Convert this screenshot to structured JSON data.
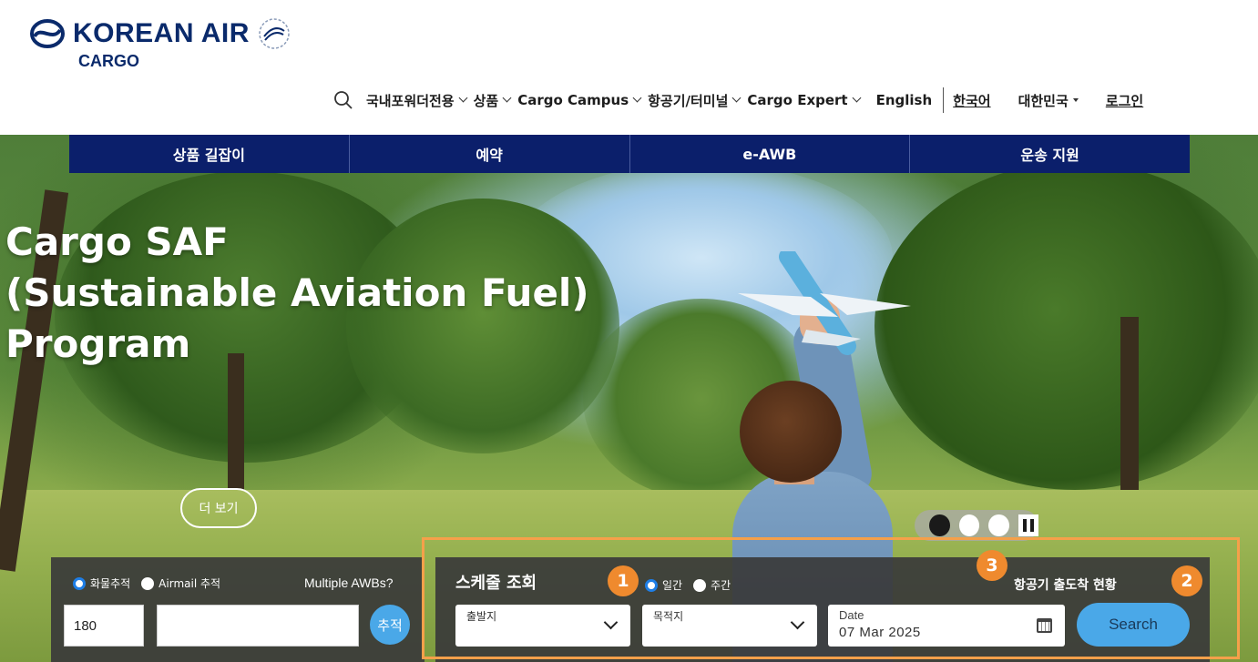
{
  "brand": {
    "name": "KOREAN AIR",
    "sub": "CARGO",
    "logo_icon": "korean-air-taeguk-logo",
    "emblem_icon": "skyteam-emblem",
    "color": "#0a2a6b"
  },
  "nav": {
    "search_icon": "search-icon",
    "items": [
      {
        "label": "국내포워더전용"
      },
      {
        "label": "상품"
      },
      {
        "label": "Cargo Campus"
      },
      {
        "label": "항공기/터미널"
      },
      {
        "label": "Cargo Expert"
      }
    ],
    "lang_en": "English",
    "lang_ko": "한국어",
    "region": "대한민국",
    "login": "로그인"
  },
  "tabs": [
    "상품 길잡이",
    "예약",
    "e-AWB",
    "운송 지원"
  ],
  "hero": {
    "headline_1": "Cargo SAF",
    "headline_2": "(Sustainable Aviation Fuel)",
    "headline_3": "Program",
    "more_label": "더 보기",
    "carousel": {
      "active_index": 0,
      "dots": 3,
      "control_icon": "pause-icon"
    }
  },
  "tracking": {
    "option_1": "화물추적",
    "option_2": "Airmail 추적",
    "selected": "화물추적",
    "multiple": "Multiple AWBs?",
    "prefix_value": "180",
    "awb_value": "",
    "button": "추적"
  },
  "schedule": {
    "title": "스케줄 조회",
    "option_daily": "일간",
    "option_weekly": "주간",
    "selected": "일간",
    "airport_status": "항공기 출도착 현황",
    "origin_label": "출발지",
    "destination_label": "목적지",
    "date_label": "Date",
    "date_value": "07 Mar 2025",
    "search_button": "Search"
  },
  "annotations": {
    "badge_1": "1",
    "badge_2": "2",
    "badge_3": "3",
    "color": "#f5a04a"
  },
  "colors": {
    "tab_bar": "#0b1f6b",
    "button_blue": "#4aa8e8",
    "panel": "#3a3a3a"
  }
}
